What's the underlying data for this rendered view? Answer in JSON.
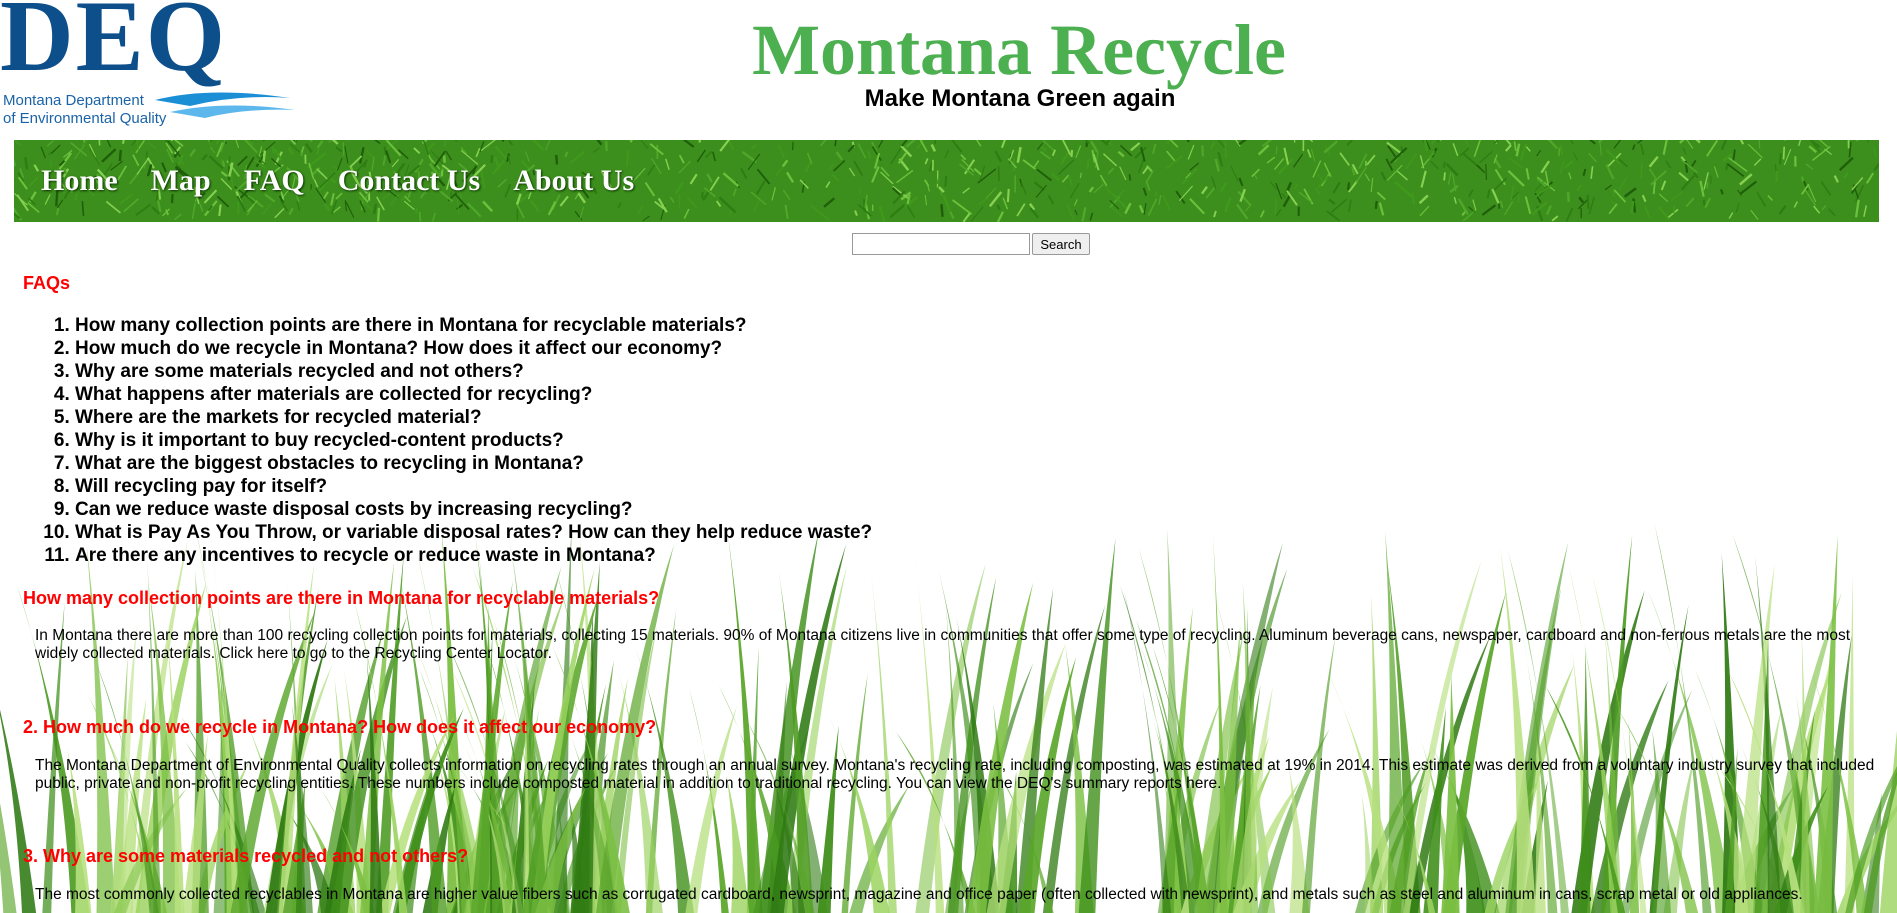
{
  "header": {
    "logo_letters": "DEQ",
    "logo_line1": "Montana Department",
    "logo_line2": "of Environmental Quality",
    "title": "Montana Recycle",
    "tagline": "Make Montana Green again"
  },
  "nav": {
    "items": [
      "Home",
      "Map",
      "FAQ",
      "Contact Us",
      "About Us"
    ]
  },
  "search": {
    "value": "",
    "button_label": "Search"
  },
  "faq": {
    "heading": "FAQs",
    "questions": [
      "How many collection points are there in Montana for recyclable materials?",
      "How much do we recycle in Montana? How does it affect our economy?",
      "Why are some materials recycled and not others?",
      "What happens after materials are collected for recycling?",
      "Where are the markets for recycled material?",
      "Why is it important to buy recycled-content products?",
      "What are the biggest obstacles to recycling in Montana?",
      "Will recycling pay for itself?",
      "Can we reduce waste disposal costs by increasing recycling?",
      "What is Pay As You Throw, or variable disposal rates? How can they help reduce waste?",
      "Are there any incentives to recycle or reduce waste in Montana?"
    ]
  },
  "answers": {
    "q1_heading": "How many collection points are there in Montana for recyclable materials?",
    "a1": "In Montana there are more than 100 recycling collection points for materials, collecting 15 materials. 90% of Montana citizens live in communities that offer some type of recycling. Aluminum beverage cans, newspaper, cardboard and non-ferrous metals are the most widely collected materials. Click here to go to the Recycling Center Locator.",
    "q2_heading": "2. How much do we recycle in Montana? How does it affect our economy?",
    "a2": "The Montana Department of Environmental Quality collects information on recycling rates through an annual survey. Montana's recycling rate, including composting, was estimated at 19% in 2014. This estimate was derived from a voluntary industry survey that included public, private and non-profit recycling entities. These numbers include composted material in addition to traditional recycling. You can view the DEQ's summary reports here.",
    "q3_heading": "3. Why are some materials recycled and not others?",
    "a3": "The most commonly collected recyclables in Montana are higher value fibers such as corrugated cardboard, newsprint, magazine and office paper (often collected with newsprint), and metals such as steel and aluminum in cans, scrap metal or old appliances."
  },
  "colors": {
    "title_green": "#4caf50",
    "heading_red": "#ff0000",
    "logo_blue": "#0d4f8b",
    "nav_green": "#3d8f1d"
  }
}
